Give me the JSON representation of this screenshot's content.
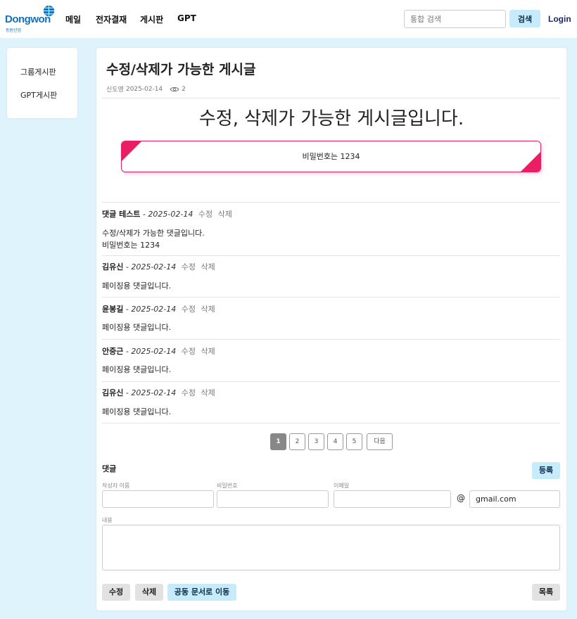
{
  "header": {
    "logo_text": "Dongwon",
    "logo_sub": "동원산업",
    "nav": [
      "메일",
      "전자결재",
      "게시판",
      "GPT"
    ],
    "search_placeholder": "통합 검색",
    "search_button": "검색",
    "login": "Login"
  },
  "sidebar": {
    "items": [
      "그룹게시판",
      "GPT게시판"
    ]
  },
  "post": {
    "title": "수정/삭제가 가능한 게시글",
    "author": "신도영",
    "date": "2025-02-14",
    "views": "2",
    "headline": "수정, 삭제가 가능한 게시글입니다.",
    "notice": "비밀번호는 1234"
  },
  "comments": [
    {
      "author": "댓글 테스트",
      "date": "2025-02-14",
      "edit": "수정",
      "delete": "삭제",
      "lines": [
        "수정/삭제가 가능한 댓글입니다.",
        "비밀번호는 1234"
      ]
    },
    {
      "author": "김유신",
      "date": "2025-02-14",
      "edit": "수정",
      "delete": "삭제",
      "lines": [
        "페이징용 댓글입니다."
      ]
    },
    {
      "author": "윤봉길",
      "date": "2025-02-14",
      "edit": "수정",
      "delete": "삭제",
      "lines": [
        "페이징용 댓글입니다."
      ]
    },
    {
      "author": "안중근",
      "date": "2025-02-14",
      "edit": "수정",
      "delete": "삭제",
      "lines": [
        "페이징용 댓글입니다."
      ]
    },
    {
      "author": "김유신",
      "date": "2025-02-14",
      "edit": "수정",
      "delete": "삭제",
      "lines": [
        "페이징용 댓글입니다."
      ]
    }
  ],
  "pagination": {
    "pages": [
      "1",
      "2",
      "3",
      "4",
      "5"
    ],
    "current": "1",
    "next": "다음"
  },
  "comment_form": {
    "title": "댓글",
    "submit": "등록",
    "name_label": "작성자 이름",
    "password_label": "비밀번호",
    "email_label": "이메일",
    "at": "@",
    "email_domain": "gmail.com",
    "content_label": "내용"
  },
  "actions": {
    "edit": "수정",
    "delete": "삭제",
    "move": "공동 문서로 이동",
    "list": "목록"
  },
  "colors": {
    "accent": "#c6ecfb",
    "notice_border": "#e91e63",
    "background": "#dff3fc"
  }
}
